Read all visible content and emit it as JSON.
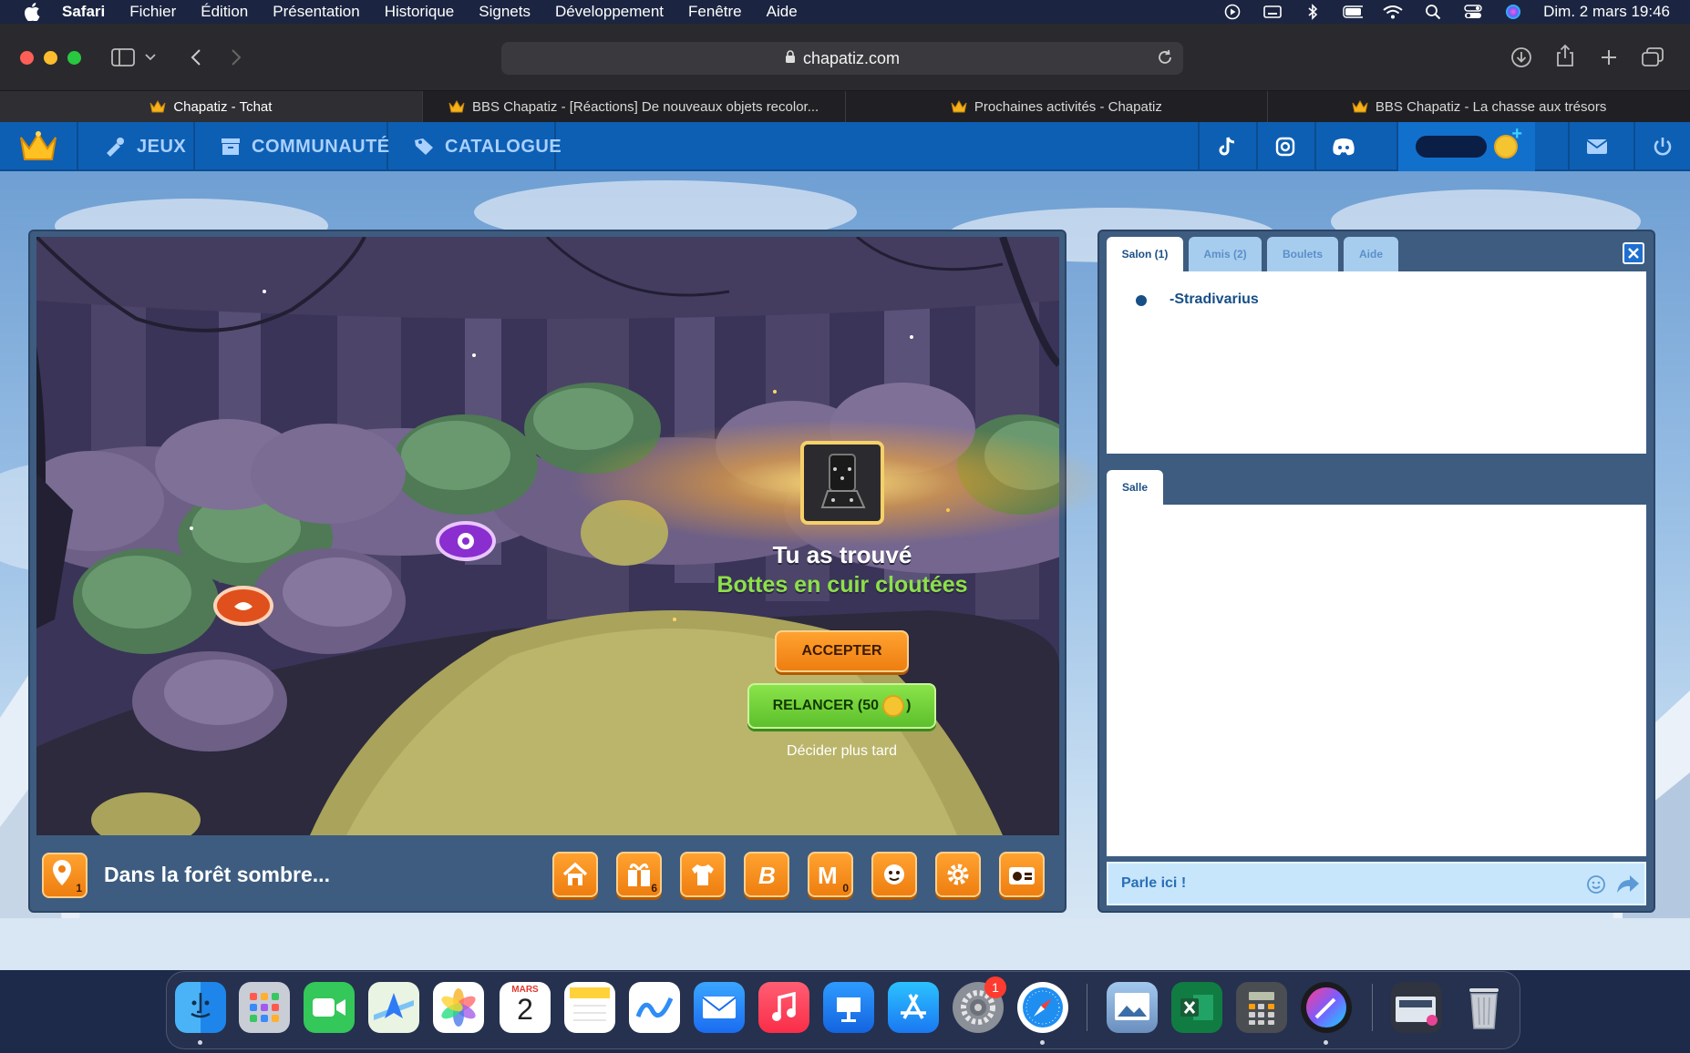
{
  "menubar": {
    "app_name": "Safari",
    "items": [
      "Fichier",
      "Édition",
      "Présentation",
      "Historique",
      "Signets",
      "Développement",
      "Fenêtre",
      "Aide"
    ],
    "clock": "Dim. 2 mars  19:46"
  },
  "browser": {
    "url": "chapatiz.com",
    "tabs": [
      {
        "label": "Chapatiz - Tchat",
        "active": true
      },
      {
        "label": "BBS Chapatiz - [Réactions] De nouveaux objets recolor...",
        "active": false
      },
      {
        "label": "Prochaines activités - Chapatiz",
        "active": false
      },
      {
        "label": "BBS Chapatiz - La chasse aux trésors",
        "active": false
      }
    ]
  },
  "site_nav": {
    "items": [
      "JEUX",
      "COMMUNAUTÉ",
      "CATALOGUE"
    ],
    "plus": "+"
  },
  "game": {
    "found_title": "Tu as trouvé",
    "found_item": "Bottes en cuir cloutées",
    "accept_label": "ACCEPTER",
    "reroll_prefix": "RELANCER (50",
    "reroll_suffix": ")",
    "decide_later": "Décider plus tard",
    "location": "Dans la forêt sombre...",
    "location_badge": "1",
    "gift_badge": "6",
    "mail_badge": "0"
  },
  "chat": {
    "tabs": [
      "Salon (1)",
      "Amis (2)",
      "Boulets",
      "Aide"
    ],
    "users": [
      "-Stradivarius"
    ],
    "room_tab": "Salle",
    "input_placeholder": "Parle ici !"
  },
  "dock": {
    "calendar_month": "MARS",
    "calendar_day": "2",
    "settings_badge": "1"
  },
  "colors": {
    "nav_blue": "#0d5fb3",
    "accept_orange": "#ee7e10",
    "reroll_green": "#5cc02c",
    "found_item_green": "#8de04a"
  }
}
